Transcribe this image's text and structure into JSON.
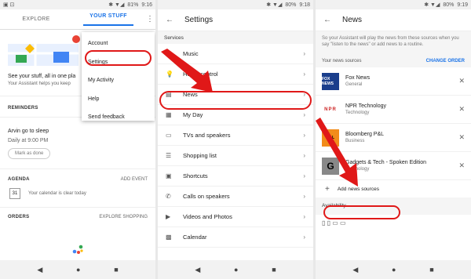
{
  "status": {
    "p1": {
      "battery": "81%",
      "time": "9:16"
    },
    "p2": {
      "battery": "80%",
      "time": "9:18"
    },
    "p3": {
      "battery": "80%",
      "time": "9:19"
    }
  },
  "p1": {
    "tabs": [
      "EXPLORE",
      "YOUR STUFF"
    ],
    "tagline1": "See your stuff, all in one pla",
    "tagline2": "Your Assistant helps you keep",
    "reminders_label": "REMINDERS",
    "reminder_title": "Arvin go to sleep",
    "reminder_time": "Daily at 9:00 PM",
    "mark_done": "Mark as done",
    "agenda_label": "AGENDA",
    "add_event": "ADD EVENT",
    "cal_day": "31",
    "calendar_clear": "Your calendar is clear today",
    "orders_label": "ORDERS",
    "explore_shopping": "EXPLORE SHOPPING",
    "menu": [
      "Account",
      "Settings",
      "My Activity",
      "Help",
      "Send feedback"
    ]
  },
  "p2": {
    "title": "Settings",
    "services_label": "Services",
    "items": [
      "Music",
      "Home control",
      "News",
      "My Day",
      "TVs and speakers",
      "Shopping list",
      "Shortcuts",
      "Calls on speakers",
      "Videos and Photos",
      "Calendar"
    ]
  },
  "p3": {
    "title": "News",
    "desc": "So your Assistant will play the news from these sources when you say \"listen to the news\" or add news to a routine.",
    "sources_label": "Your news sources",
    "change_order": "CHANGE ORDER",
    "sources": [
      {
        "name": "Fox News",
        "category": "General",
        "logo": "FOX NEWS"
      },
      {
        "name": "NPR Technology",
        "category": "Technology",
        "logo": "NPR"
      },
      {
        "name": "Bloomberg P&L",
        "category": "Business",
        "logo": "P&L"
      },
      {
        "name": "Gadgets & Tech - Spoken Edition",
        "category": "Technology",
        "logo": "G"
      }
    ],
    "add_sources": "Add news sources",
    "availability": "Availability"
  },
  "colors": {
    "accent": "#1a73e8",
    "highlight": "#e01818"
  }
}
